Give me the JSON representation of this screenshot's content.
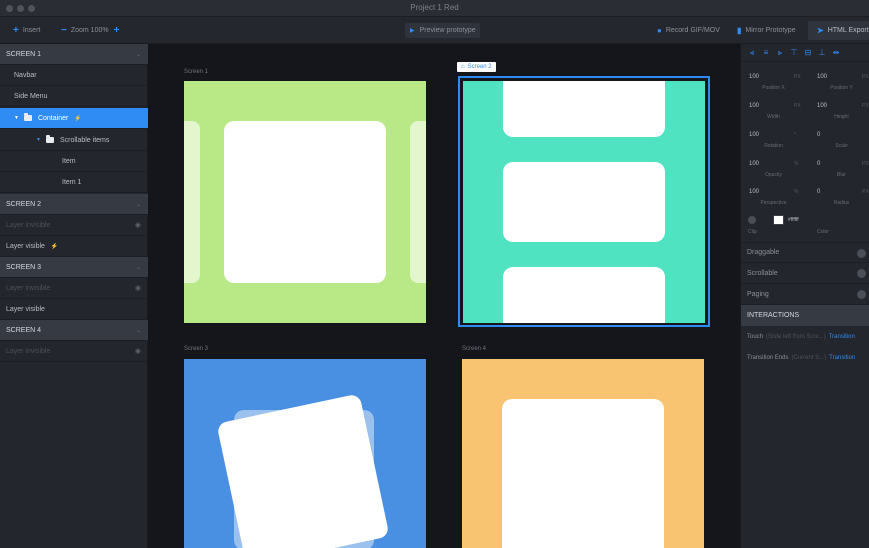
{
  "window": {
    "title": "Project 1 Red"
  },
  "toolbar": {
    "insert": "Insert",
    "zoom": "Zoom 100%",
    "preview": "Preview prototype",
    "record": "Record GIF/MOV",
    "mirror": "Mirror Prototype",
    "export": "HTML Export"
  },
  "layers": {
    "screen1": "SCREEN 1",
    "navbar": "Navbar",
    "side_menu": "Side Menu",
    "container": "Container",
    "scrollable": "Scrollable items",
    "item": "Item",
    "item1": "Item 1",
    "screen2": "SCREEN 2",
    "layer_invisible_1": "Layer invisible",
    "layer_visible_1": "Layer visible",
    "screen3": "SCREEN 3",
    "layer_invisible_2": "Layer invisible",
    "layer_visible_2": "Layer visible",
    "screen4": "SCREEN 4",
    "layer_invisible_3": "Layer invisible"
  },
  "canvas": {
    "screen1_label": "Screen 1",
    "screen2_label": "Screen 2",
    "screen3_label": "Screen 3",
    "screen4_label": "Screen 4",
    "colors": {
      "screen1": "#b8e986",
      "screen2": "#50e3c2",
      "screen3": "#4a90e2",
      "screen4": "#f8c471"
    }
  },
  "props": {
    "pos_x": {
      "value": "100",
      "unit": "PX",
      "label": "Position X"
    },
    "pos_y": {
      "value": "100",
      "unit": "PX",
      "label": "Position Y"
    },
    "width": {
      "value": "100",
      "unit": "PX",
      "label": "Width"
    },
    "height": {
      "value": "100",
      "unit": "PX",
      "label": "Height"
    },
    "rotation": {
      "value": "100",
      "unit": "°",
      "label": "Rotation"
    },
    "scale": {
      "value": "0",
      "unit": "",
      "label": "Scale"
    },
    "opacity": {
      "value": "100",
      "unit": "%",
      "label": "Opacity"
    },
    "blur": {
      "value": "0",
      "unit": "PX",
      "label": "Blur"
    },
    "perspective": {
      "value": "100",
      "unit": "%",
      "label": "Perspective"
    },
    "radius": {
      "value": "0",
      "unit": "PX",
      "label": "Radius"
    },
    "clip_label": "Clip",
    "color_value": "#ffffff",
    "color_label": "Color",
    "draggable": "Draggable",
    "scrollable": "Scrollable",
    "paging": "Paging"
  },
  "interactions": {
    "title": "INTERACTIONS",
    "row1_event": "Touch",
    "row1_target": "(Slide left from Scre...)",
    "row1_action": "Transition",
    "row2_event": "Transition Ends",
    "row2_target": "(Current S...)",
    "row2_action": "Transition"
  }
}
